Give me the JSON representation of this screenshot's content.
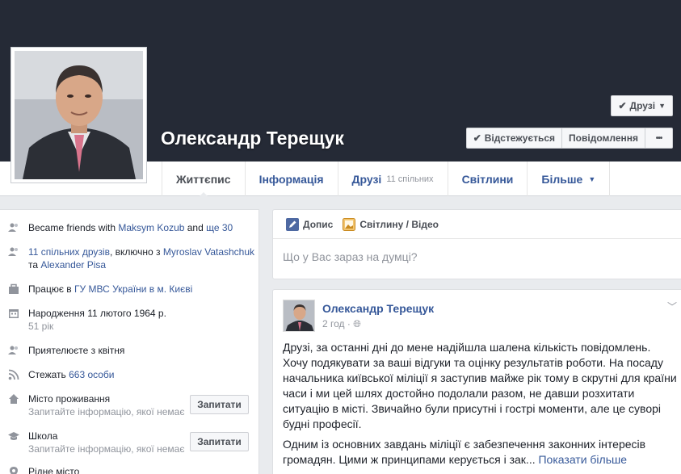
{
  "profile": {
    "name": "Олександр Терещук"
  },
  "header_actions": {
    "friends": "Друзі",
    "following": "Відстежується",
    "message": "Повідомлення",
    "more": "•••"
  },
  "tabs": [
    {
      "label": "Життєпис",
      "active": true
    },
    {
      "label": "Інформація"
    },
    {
      "label": "Друзі",
      "sub": "11 спільних"
    },
    {
      "label": "Світлини"
    },
    {
      "label": "Більше"
    }
  ],
  "sidebar": {
    "friends_recent": {
      "prefix": "Became friends with ",
      "link1": "Maksym Kozub",
      "middle": " and ",
      "link2": "ще 30"
    },
    "mutual": {
      "link1": "11 спільних друзів",
      "middle1": ", включно з ",
      "link2": "Myroslav Vatashchuk",
      "middle2": " та ",
      "link3": "Alexander Pisa"
    },
    "work": {
      "prefix": "Працює в ",
      "link": "ГУ МВС України в м. Києві"
    },
    "birthday": {
      "text": "Народження 11 лютого 1964 р.",
      "age": "51 рік"
    },
    "friends_since": "Приятелюєте з квітня",
    "followers": {
      "prefix": "Стежать ",
      "link": "663 особи"
    },
    "city": {
      "title": "Місто проживання",
      "hint": "Запитайте інформацію, якої немає",
      "button": "Запитати"
    },
    "school": {
      "title": "Школа",
      "hint": "Запитайте інформацію, якої немає",
      "button": "Запитати"
    },
    "hometown": {
      "title": "Рідне місто"
    }
  },
  "composer": {
    "tab_post": "Допис",
    "tab_photo": "Світлину / Відео",
    "placeholder": "Що у Вас зараз на думці?"
  },
  "post": {
    "author": "Олександр Терещук",
    "time": "2 год",
    "paragraph1": "Друзі, за останні дні до мене надійшла шалена кількість повідомлень. Хочу подякувати за ваші відгуки та оцінку результатів роботи. На посаду начальника київської міліції я заступив майже рік тому в скрутні для країни часи і ми цей шлях достойно подолали разом, не давши розхитати ситуацію в місті. Звичайно були присутні і гострі моменти, але це суворі будні професії.",
    "paragraph2": "Одним із основних завдань міліції є забезпечення законних інтересів громадян. Цими ж принципами керується і зак...",
    "see_more": "Показати більше"
  },
  "colors": {
    "cover": "#252a36",
    "link": "#365899",
    "background": "#e9ebee"
  }
}
